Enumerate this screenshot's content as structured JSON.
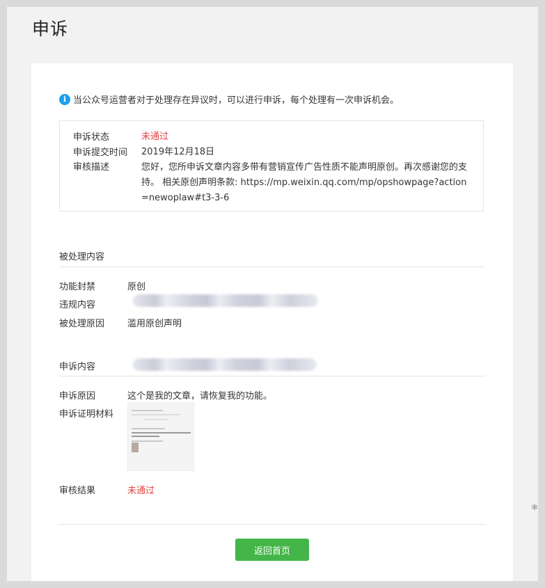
{
  "page": {
    "title": "申诉"
  },
  "notice": {
    "icon": "info-icon",
    "text": "当公众号运营者对于处理存在异议时，可以进行申诉，每个处理有一次申诉机会。"
  },
  "status": {
    "rows": [
      {
        "label": "申诉状态",
        "value": "未通过"
      },
      {
        "label": "申诉提交时间",
        "value": "2019年12月18日"
      },
      {
        "label": "审核描述",
        "value": "您好，您所申诉文章内容多带有营销宣传广告性质不能声明原创。再次感谢您的支持。 相关原创声明条款: https://mp.weixin.qq.com/mp/opshowpage?action=newoplaw#t3-3-6"
      }
    ]
  },
  "handled": {
    "title": "被处理内容",
    "rows": [
      {
        "label": "功能封禁",
        "value": "原创"
      },
      {
        "label": "违规内容",
        "value": ""
      },
      {
        "label": "被处理原因",
        "value": "滥用原创声明"
      }
    ]
  },
  "appeal": {
    "title": "申诉内容",
    "rows": [
      {
        "label": "申诉原因",
        "value": "这个是我的文章，请恢复我的功能。"
      },
      {
        "label": "申诉证明材料",
        "value": ""
      },
      {
        "label": "审核结果",
        "value": "未通过"
      }
    ]
  },
  "actions": {
    "return_label": "返回首页"
  },
  "colors": {
    "accent_green": "#44b549",
    "error_red": "#e64340",
    "info_blue": "#1aa1f0"
  }
}
